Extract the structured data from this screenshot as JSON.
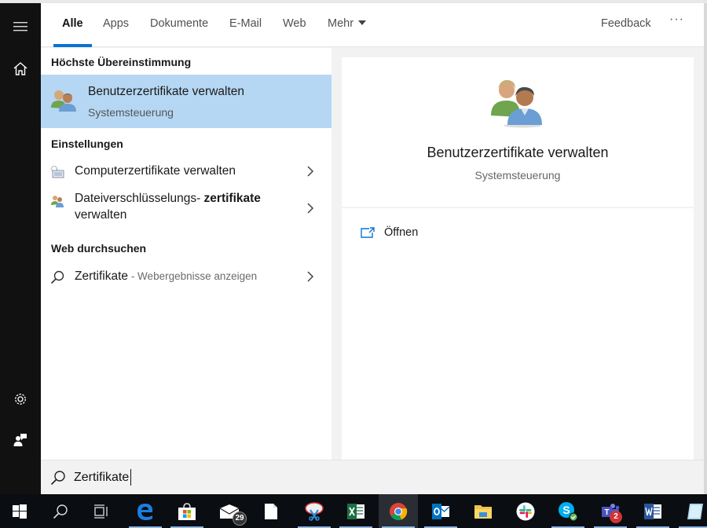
{
  "tabs": [
    {
      "label": "Alle",
      "active": true
    },
    {
      "label": "Apps"
    },
    {
      "label": "Dokumente"
    },
    {
      "label": "E-Mail"
    },
    {
      "label": "Web"
    },
    {
      "label": "Mehr",
      "has_dropdown": true
    }
  ],
  "header": {
    "feedback_label": "Feedback",
    "more_label": "···"
  },
  "rail": {
    "top": [
      {
        "icon": "hamburger-menu-icon"
      },
      {
        "icon": "home-icon"
      }
    ],
    "bottom": [
      {
        "icon": "gear-icon"
      },
      {
        "icon": "feedback-person-icon"
      }
    ]
  },
  "results": {
    "best_match_heading": "Höchste Übereinstimmung",
    "best_match": {
      "title": "Benutzerzertifikate verwalten",
      "subtitle": "Systemsteuerung",
      "icon": "users-icon"
    },
    "settings_heading": "Einstellungen",
    "settings": [
      {
        "text": "Computerzertifikate verwalten",
        "icon": "computer-certificate-icon"
      },
      {
        "text_normal": "Dateiverschlüsselungs- ",
        "text_bold": "zertifikate",
        "text_line2": "verwalten",
        "icon": "users-small-icon"
      }
    ],
    "web_heading": "Web durchsuchen",
    "web": [
      {
        "query": "Zertifikate",
        "suffix": " - Webergebnisse anzeigen",
        "icon": "search-icon"
      }
    ]
  },
  "detail": {
    "title": "Benutzerzertifikate verwalten",
    "subtitle": "Systemsteuerung",
    "actions": [
      {
        "label": "Öffnen",
        "icon": "open-external-icon"
      }
    ]
  },
  "search": {
    "value": "Zertifikate",
    "placeholder": ""
  },
  "taskbar": {
    "apps": [
      {
        "name": "start",
        "icon": "windows-icon"
      },
      {
        "name": "search",
        "icon": "search-icon"
      },
      {
        "name": "task-view",
        "icon": "task-view-icon"
      },
      {
        "name": "edge",
        "icon": "edge-icon",
        "running": true
      },
      {
        "name": "store",
        "icon": "store-icon",
        "running": true
      },
      {
        "name": "mail",
        "icon": "mail-icon",
        "badge": "29"
      },
      {
        "name": "file",
        "icon": "document-icon"
      },
      {
        "name": "snipping-tool",
        "icon": "snipping-icon",
        "running": true
      },
      {
        "name": "excel",
        "icon": "excel-icon",
        "running": true
      },
      {
        "name": "chrome",
        "icon": "chrome-icon",
        "running": true,
        "active": true
      },
      {
        "name": "outlook",
        "icon": "outlook-icon",
        "running": true
      },
      {
        "name": "file-explorer",
        "icon": "folder-icon"
      },
      {
        "name": "slack",
        "icon": "slack-icon"
      },
      {
        "name": "skype",
        "icon": "skype-icon",
        "running": true
      },
      {
        "name": "teams",
        "icon": "teams-icon",
        "badge": "2",
        "running": true
      },
      {
        "name": "word",
        "icon": "word-icon",
        "running": true
      },
      {
        "name": "notepad",
        "icon": "notepad-icon",
        "running": true
      }
    ]
  },
  "colors": {
    "accent": "#0a74d4",
    "selection": "#b5d7f3",
    "rail": "#111111",
    "panel_bg": "#f2f2f2",
    "taskbar": "#0a0d12"
  }
}
